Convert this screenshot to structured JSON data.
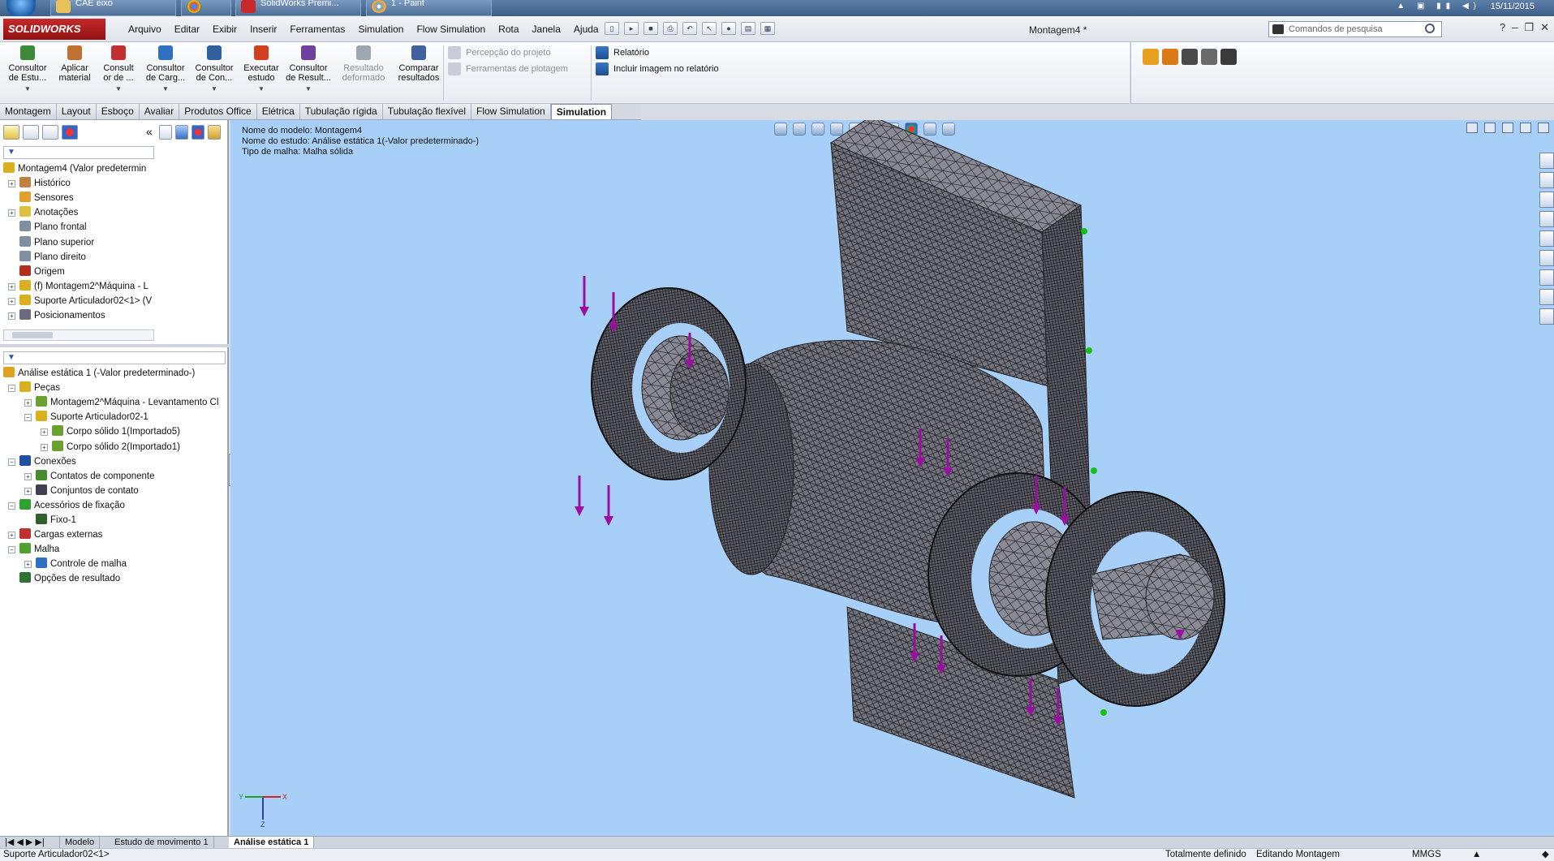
{
  "taskbar": {
    "tasks": [
      "CAE eixo",
      "",
      "SolidWorks Premi...",
      "1 - Paint"
    ],
    "clock": "15/11/2015"
  },
  "app": {
    "logo": "SOLIDWORKS",
    "menu": [
      "Arquivo",
      "Editar",
      "Exibir",
      "Inserir",
      "Ferramentas",
      "Simulation",
      "Flow Simulation",
      "Rota",
      "Janela",
      "Ajuda"
    ],
    "document_title": "Montagem4 *",
    "search_placeholder": "Comandos de pesquisa"
  },
  "ribbon": {
    "buttons": [
      {
        "label1": "Consultor",
        "label2": "de Estu...",
        "icon": "study-advisor-icon"
      },
      {
        "label1": "Aplicar",
        "label2": "material",
        "icon": "apply-material-icon"
      },
      {
        "label1": "Consult",
        "label2": "or de ...",
        "icon": "fixtures-advisor-icon"
      },
      {
        "label1": "Consultor",
        "label2": "de Carg...",
        "icon": "loads-advisor-icon"
      },
      {
        "label1": "Consultor",
        "label2": "de Con...",
        "icon": "connections-advisor-icon"
      },
      {
        "label1": "Executar",
        "label2": "estudo",
        "icon": "run-study-icon"
      },
      {
        "label1": "Consultor",
        "label2": "de Result...",
        "icon": "results-advisor-icon"
      },
      {
        "label1": "Resultado",
        "label2": "deformado",
        "icon": "deformed-result-icon",
        "disabled": true
      },
      {
        "label1": "Comparar",
        "label2": "resultados",
        "icon": "compare-results-icon"
      }
    ],
    "rows_disabled": [
      "Percepção do projeto",
      "Ferramentas de plotagem"
    ],
    "rows": [
      "Relatório",
      "Incluir imagem no relatório"
    ]
  },
  "tabs": [
    "Montagem",
    "Layout",
    "Esboço",
    "Avaliar",
    "Produtos Office",
    "Elétrica",
    "Tubulação rígida",
    "Tubulação flexível",
    "Flow Simulation",
    "Simulation"
  ],
  "active_tab": "Simulation",
  "feature_tree": [
    {
      "label": "Montagem4  (Valor predetermin",
      "icon": "assembly-icon",
      "indent": 0,
      "expander": ""
    },
    {
      "label": "Histórico",
      "icon": "history-icon",
      "indent": 1,
      "expander": "+"
    },
    {
      "label": "Sensores",
      "icon": "sensors-icon",
      "indent": 1,
      "expander": ""
    },
    {
      "label": "Anotações",
      "icon": "annotations-icon",
      "indent": 1,
      "expander": "+"
    },
    {
      "label": "Plano frontal",
      "icon": "plane-icon",
      "indent": 1,
      "expander": ""
    },
    {
      "label": "Plano superior",
      "icon": "plane-icon",
      "indent": 1,
      "expander": ""
    },
    {
      "label": "Plano direito",
      "icon": "plane-icon",
      "indent": 1,
      "expander": ""
    },
    {
      "label": "Origem",
      "icon": "origin-icon",
      "indent": 1,
      "expander": ""
    },
    {
      "label": "(f) Montagem2^Máquina - L",
      "icon": "subassembly-icon",
      "indent": 1,
      "expander": "+"
    },
    {
      "label": "Suporte Articulador02<1> (V",
      "icon": "subassembly-icon",
      "indent": 1,
      "expander": "+"
    },
    {
      "label": "Posicionamentos",
      "icon": "mates-icon",
      "indent": 1,
      "expander": "+"
    }
  ],
  "sim_tree": [
    {
      "label": "Análise estática 1 (-Valor predeterminado-)",
      "icon": "static-study-icon",
      "indent": 0,
      "expander": ""
    },
    {
      "label": "Peças",
      "icon": "parts-icon",
      "indent": 1,
      "expander": "-"
    },
    {
      "label": "Montagem2^Máquina - Levantamento Cl",
      "icon": "mesh-part-icon",
      "indent": 2,
      "expander": "+"
    },
    {
      "label": "Suporte Articulador02-1",
      "icon": "subassembly-icon",
      "indent": 2,
      "expander": "-"
    },
    {
      "label": "Corpo sólido 1(Importado5)",
      "icon": "mesh-part-icon",
      "indent": 3,
      "expander": "+"
    },
    {
      "label": "Corpo sólido 2(Importado1)",
      "icon": "mesh-part-icon",
      "indent": 3,
      "expander": "+"
    },
    {
      "label": "Conexões",
      "icon": "connections-icon",
      "indent": 1,
      "expander": "-"
    },
    {
      "label": "Contatos de componente",
      "icon": "contact-icon",
      "indent": 2,
      "expander": "+"
    },
    {
      "label": "Conjuntos de contato",
      "icon": "contact-set-icon",
      "indent": 2,
      "expander": "+"
    },
    {
      "label": "Acessórios de fixação",
      "icon": "fixtures-icon",
      "indent": 1,
      "expander": "-"
    },
    {
      "label": "Fixo-1",
      "icon": "fixed-icon",
      "indent": 2,
      "expander": ""
    },
    {
      "label": "Cargas externas",
      "icon": "external-loads-icon",
      "indent": 1,
      "expander": "+"
    },
    {
      "label": "Malha",
      "icon": "mesh-icon",
      "indent": 1,
      "expander": "-"
    },
    {
      "label": "Controle de malha",
      "icon": "mesh-control-icon",
      "indent": 2,
      "expander": "+"
    },
    {
      "label": "Opções de resultado",
      "icon": "result-options-icon",
      "indent": 1,
      "expander": ""
    }
  ],
  "viewport": {
    "info": [
      "Nome do modelo: Montagem4",
      "Nome do estudo: Análise estática 1(-Valor predeterminado-)",
      "Tipo de malha: Malha sólida"
    ],
    "triad": {
      "x": "X",
      "y": "Y",
      "z": "Z"
    }
  },
  "bottom_tabs": [
    "Modelo",
    "Estudo de movimento 1",
    "Análise estática 1"
  ],
  "status": {
    "left": "Suporte Articulador02<1>",
    "defined": "Totalmente definido",
    "mode": "Editando Montagem",
    "units": "MMGS"
  },
  "colors": {
    "viewport_bg": "#a8cff8",
    "load_arrow": "#9b0fa0",
    "fixture": "#16c016",
    "mesh_fill": "#6b6b75"
  }
}
